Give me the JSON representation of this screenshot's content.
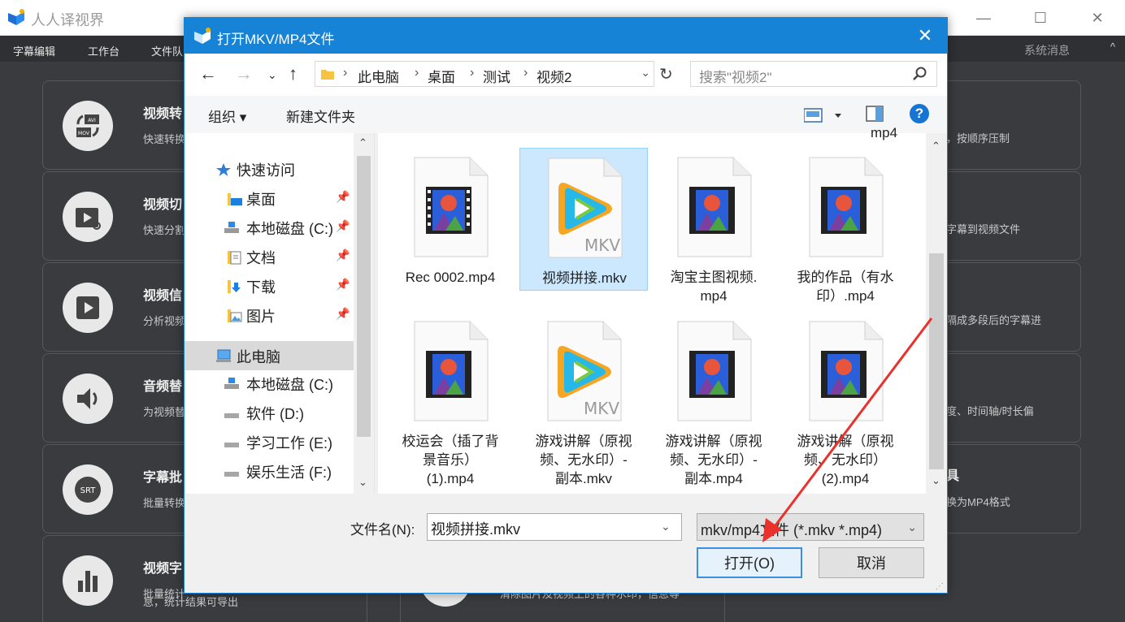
{
  "app": {
    "title": "人人译视界",
    "menu": [
      "字幕编辑",
      "工作台",
      "文件队"
    ],
    "system_messages": "系统消息",
    "collapse_icon": "^"
  },
  "cards": [
    {
      "title": "视频转",
      "desc": "快速转换",
      "icon": "video-convert-icon"
    },
    {
      "title": "视频切",
      "desc": "快速分割",
      "icon": "video-cut-icon"
    },
    {
      "title": "视频信",
      "desc": "分析视频",
      "icon": "video-info-icon"
    },
    {
      "title": "音频替",
      "desc": "为视频替",
      "icon": "audio-replace-icon"
    },
    {
      "title": "字幕批",
      "desc": "批量转换",
      "icon": "srt-icon",
      "icon_text": "SRT"
    },
    {
      "title": "视频字",
      "desc": "批量统计",
      "desc2": "息，统计结果可导出",
      "icon": "chart-icon"
    }
  ],
  "right_cards": [
    {
      "text": "，按顺序压制"
    },
    {
      "text": "字幕到视频文件"
    },
    {
      "text": "隔成多段后的字幕进"
    },
    {
      "text": "度、时间轴/时长偏"
    },
    {
      "text": "换为MP4格式",
      "title": "具"
    },
    {
      "text": "清除图片及视频上的各种水印，信息等"
    }
  ],
  "dialog": {
    "title": "打开MKV/MP4文件",
    "address": [
      "此电脑",
      "桌面",
      "测试",
      "视频2"
    ],
    "search_placeholder": "搜索\"视频2\"",
    "organize": "组织 ▾",
    "new_folder": "新建文件夹",
    "help": "?",
    "nav_items": [
      {
        "label": "快速访问",
        "icon": "star-icon"
      },
      {
        "label": "桌面",
        "icon": "desktop-folder-icon",
        "pinned": true
      },
      {
        "label": "本地磁盘 (C:)",
        "icon": "drive-icon",
        "pinned": true
      },
      {
        "label": "文档",
        "icon": "documents-icon",
        "pinned": true
      },
      {
        "label": "下载",
        "icon": "downloads-icon",
        "pinned": true
      },
      {
        "label": "图片",
        "icon": "pictures-icon",
        "pinned": true
      },
      {
        "label": "此电脑",
        "icon": "computer-icon",
        "selected": true
      },
      {
        "label": "本地磁盘 (C:)",
        "icon": "drive-icon"
      },
      {
        "label": "软件 (D:)",
        "icon": "drive-icon"
      },
      {
        "label": "学习工作 (E:)",
        "icon": "drive-icon"
      },
      {
        "label": "娱乐生活 (F:)",
        "icon": "drive-icon"
      }
    ],
    "partial_top_label": "mp4",
    "files": [
      {
        "name": "Rec 0002.mp4",
        "type": "mp4"
      },
      {
        "name": "视频拼接.mkv",
        "type": "mkv",
        "selected": true
      },
      {
        "name": "淘宝主图视频.\nmp4",
        "type": "mp4"
      },
      {
        "name": "我的作品（有水\n印）.mp4",
        "type": "mp4"
      },
      {
        "name": "校运会（插了背\n景音乐）\n(1).mp4",
        "type": "mp4"
      },
      {
        "name": "游戏讲解（原视\n频、无水印）-\n副本.mkv",
        "type": "mkv"
      },
      {
        "name": "游戏讲解（原视\n频、无水印）-\n副本.mp4",
        "type": "mp4"
      },
      {
        "name": "游戏讲解（原视\n频、无水印）\n(2).mp4",
        "type": "mp4"
      }
    ],
    "mkv_badge": "MKV",
    "filename_label": "文件名(N):",
    "filename_value": "视频拼接.mkv",
    "filter_value": "mkv/mp4文件 (*.mkv *.mp4)",
    "open_label": "打开(O)",
    "cancel_label": "取消"
  },
  "colors": {
    "accent": "#1783d6",
    "annotation": "#e8322b",
    "selection": "#cce8ff"
  }
}
